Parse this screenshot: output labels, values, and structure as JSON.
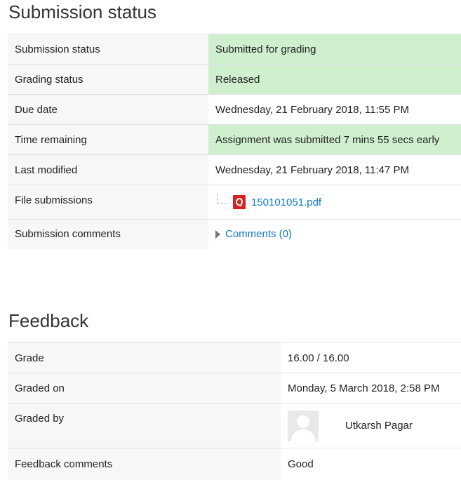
{
  "submission": {
    "heading": "Submission status",
    "rows": [
      {
        "label": "Submission status",
        "value": "Submitted for grading"
      },
      {
        "label": "Grading status",
        "value": "Released"
      },
      {
        "label": "Due date",
        "value": "Wednesday, 21 February 2018, 11:55 PM"
      },
      {
        "label": "Time remaining",
        "value": "Assignment was submitted 7 mins 55 secs early"
      },
      {
        "label": "Last modified",
        "value": "Wednesday, 21 February 2018, 11:47 PM"
      },
      {
        "label": "File submissions",
        "file_name": "150101051.pdf",
        "file_icon": "pdf-icon"
      },
      {
        "label": "Submission comments",
        "comments_link": "Comments (0)"
      }
    ]
  },
  "feedback": {
    "heading": "Feedback",
    "rows": [
      {
        "label": "Grade",
        "value": "16.00 / 16.00"
      },
      {
        "label": "Graded on",
        "value": "Monday, 5 March 2018, 2:58 PM"
      },
      {
        "label": "Graded by",
        "grader_name": "Utkarsh Pagar",
        "avatar_icon": "user-avatar"
      },
      {
        "label": "Feedback comments",
        "value": "Good"
      }
    ]
  },
  "colors": {
    "success_bg": "#cfefcf",
    "label_bg": "#f7f7f7",
    "link": "#1177d1",
    "pdf_red": "#d32222"
  }
}
